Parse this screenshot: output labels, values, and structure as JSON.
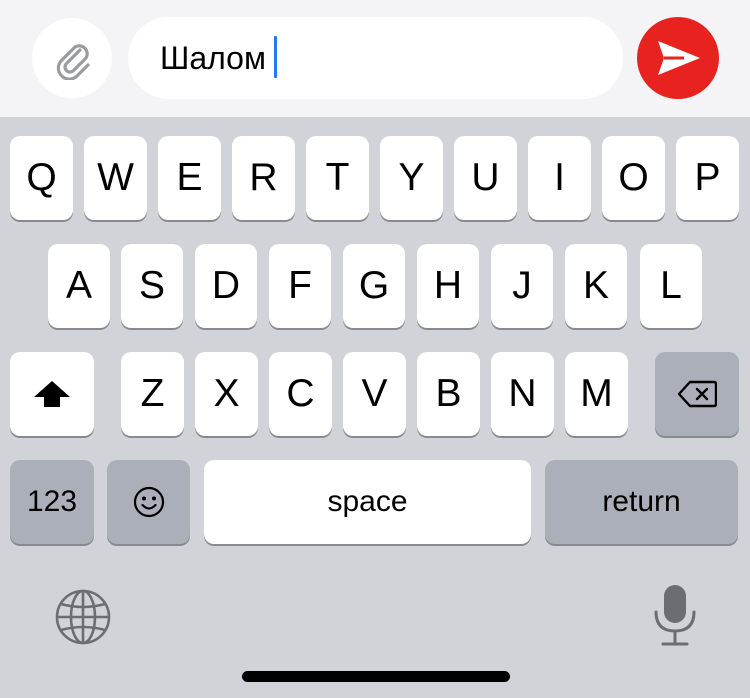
{
  "composer": {
    "text_value": "Шалом",
    "attach_icon": "paperclip-icon",
    "send_icon": "send-arrow-icon",
    "send_color": "#e8231f",
    "caret_color": "#1f7cf5"
  },
  "keyboard": {
    "row1": [
      "Q",
      "W",
      "E",
      "R",
      "T",
      "Y",
      "U",
      "I",
      "O",
      "P"
    ],
    "row2": [
      "A",
      "S",
      "D",
      "F",
      "G",
      "H",
      "J",
      "K",
      "L"
    ],
    "row3": [
      "Z",
      "X",
      "C",
      "V",
      "B",
      "N",
      "M"
    ],
    "shift_icon": "shift-arrow-icon",
    "backspace_icon": "backspace-icon",
    "numbers_label": "123",
    "emoji_icon": "emoji-icon",
    "space_label": "space",
    "return_label": "return",
    "globe_icon": "globe-icon",
    "mic_icon": "microphone-icon"
  }
}
